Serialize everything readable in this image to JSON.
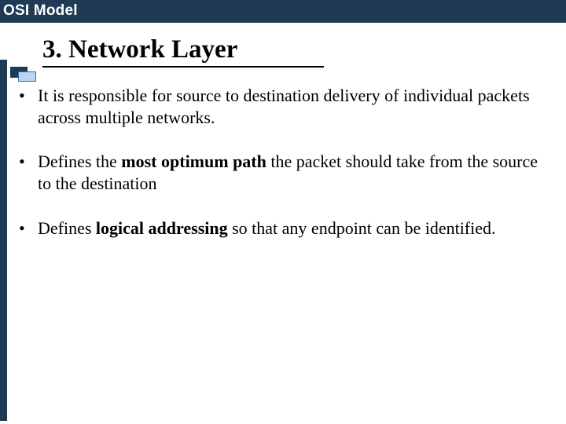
{
  "header": {
    "label": "OSI Model"
  },
  "title": "3. Network Layer",
  "bullets": [
    {
      "pre": "It is responsible for source to destination delivery of individual packets across multiple networks.",
      "bold": "",
      "post": ""
    },
    {
      "pre": "Defines the ",
      "bold": "most optimum path",
      "post": " the packet should take from the source to the destination"
    },
    {
      "pre": "Defines ",
      "bold": "logical addressing",
      "post": " so that any endpoint can be identified."
    }
  ]
}
